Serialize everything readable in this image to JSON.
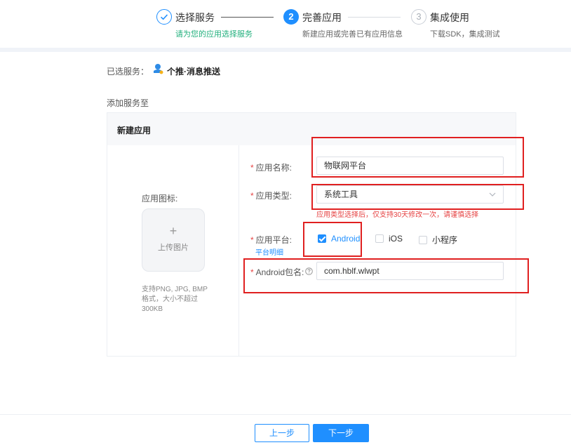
{
  "steps": [
    {
      "title": "选择服务",
      "subtitle": "请为您的应用选择服务",
      "status": "done"
    },
    {
      "number": "2",
      "title": "完善应用",
      "subtitle": "新建应用或完善已有应用信息",
      "status": "active"
    },
    {
      "number": "3",
      "title": "集成使用",
      "subtitle": "下载SDK，集成测试",
      "status": "pending"
    }
  ],
  "selected_service": {
    "label": "已选服务：",
    "name": "个推·消息推送"
  },
  "add_to_label": "添加服务至",
  "panel": {
    "title": "新建应用",
    "icon_label": "应用图标:",
    "upload_text": "上传图片",
    "upload_plus": "+",
    "upload_hint": "支持PNG, JPG, BMP格式，大小不超过300KB"
  },
  "form": {
    "required_mark": "*",
    "app_name": {
      "label": "应用名称:",
      "value": "物联网平台"
    },
    "app_type": {
      "label": "应用类型:",
      "value": "系统工具",
      "hint": "应用类型选择后，仅支持30天修改一次，请谨慎选择"
    },
    "platform": {
      "label": "应用平台:",
      "link": "平台明细",
      "options": [
        {
          "name": "Android",
          "checked": true
        },
        {
          "name": "iOS",
          "checked": false
        },
        {
          "name": "小程序",
          "checked": false
        }
      ]
    },
    "package": {
      "label": "Android包名:",
      "help_icon": "question-icon",
      "value": "com.hblf.wlwpt"
    }
  },
  "footer": {
    "prev_label": "上一步",
    "next_label": "下一步"
  },
  "colors": {
    "accent": "#1f8fff",
    "success": "#22b07d",
    "required": "#e64444",
    "annotation": "#e02020"
  }
}
